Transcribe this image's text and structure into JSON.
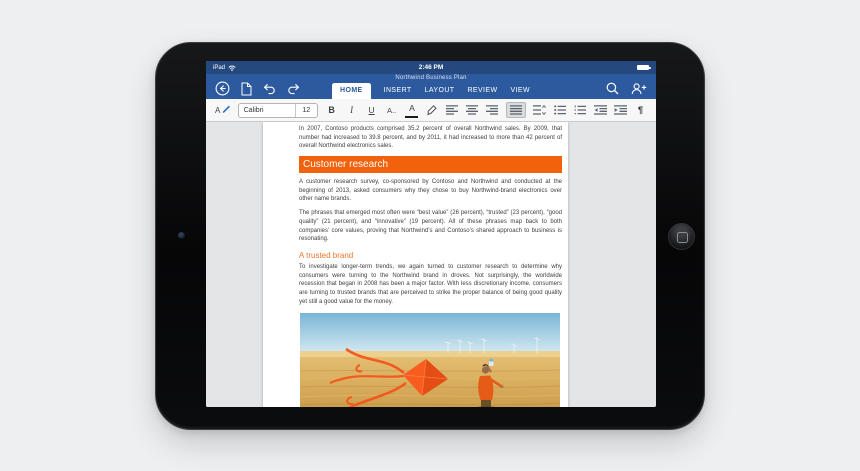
{
  "device": {
    "status": {
      "device_label": "iPad",
      "time": "2:46 PM"
    }
  },
  "app": {
    "doc_title": "Northwind Business Plan",
    "tabs": [
      {
        "label": "HOME",
        "active": true
      },
      {
        "label": "INSERT",
        "active": false
      },
      {
        "label": "LAYOUT",
        "active": false
      },
      {
        "label": "REVIEW",
        "active": false
      },
      {
        "label": "VIEW",
        "active": false
      }
    ],
    "toolbar": {
      "pen_a": "A",
      "font_name": "Calibri",
      "font_size": "12",
      "bold": "B",
      "italic": "I",
      "underline": "U",
      "effects": "A..",
      "font_color": "A",
      "pilcrow": "¶"
    }
  },
  "doc": {
    "para1": "In 2007, Contoso products comprised 35.2 percent of overall Northwind sales. By 2009, that number had increased to 39.8 percent, and by 2011, it had increased to more than 42 percent of overall Northwind electronics sales.",
    "h1": "Customer research",
    "para2": "A customer research survey, co-sponsored by Contoso and Northwind and conducted at the beginning of 2013, asked consumers why they chose to buy Northwind-brand electronics over other name brands.",
    "para3": "The phrases that emerged most often were “best value” (26 percent), “trusted” (23 percent), “good quality” (21 percent), and “innovative” (19 percent). All of these phrases map back to both companies’ core values, proving that Northwind’s and Contoso’s shared approach to business is resonating.",
    "h2": "A trusted brand",
    "para4": "To investigate longer-term trends, we again turned to customer research to determine why consumers were turning to the Northwind brand in droves. Not surprisingly, the worldwide recession that began in 2008 has been a major factor. With less discretionary income, consumers are turning to trusted brands that are perceived to strike the proper balance of being good quality yet still a good value for the money."
  },
  "colors": {
    "title_bar_blue": "#2d5a9f",
    "status_bar_blue": "#25497e",
    "heading_banner_orange": "#f2610c",
    "subheading_orange": "#ed7527",
    "active_tab_text": "#2b579a"
  }
}
